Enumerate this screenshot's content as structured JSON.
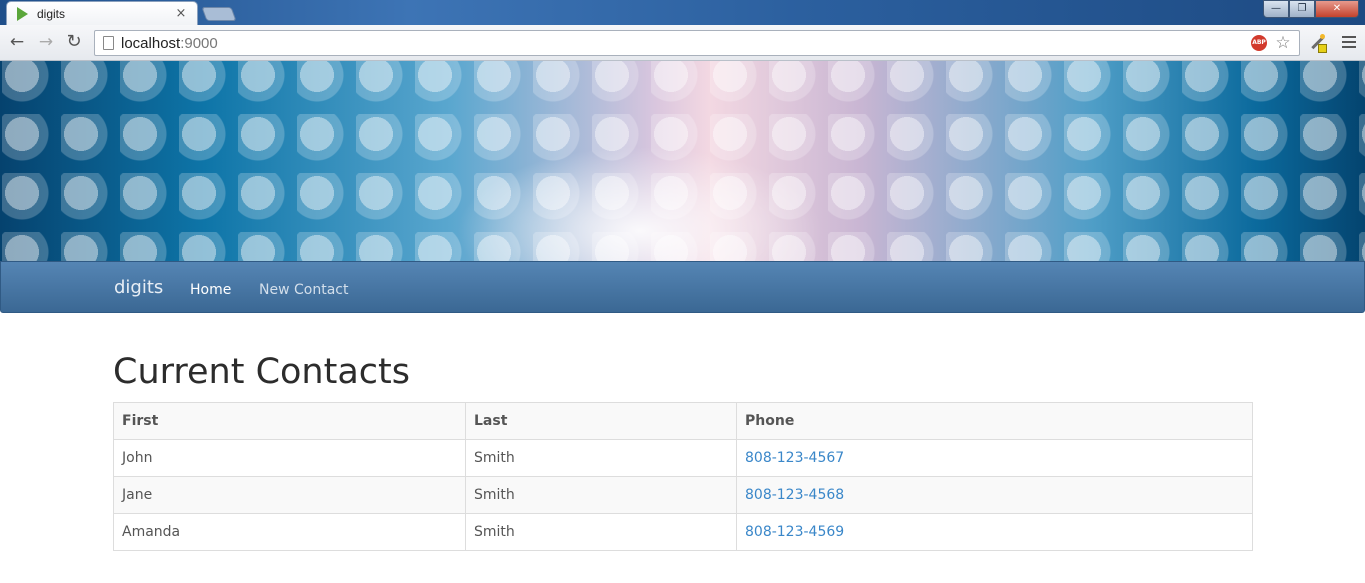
{
  "browser": {
    "tab_title": "digits",
    "tab_close": "×",
    "url_host": "localhost",
    "url_port": ":9000",
    "adblock_label": "ABP",
    "window_buttons": {
      "minimize": "—",
      "maximize": "❐",
      "close": "✕"
    },
    "icons": {
      "back": "←",
      "forward": "→",
      "reload": "↻",
      "bookmark": "☆"
    }
  },
  "navbar": {
    "brand": "digits",
    "links": [
      {
        "label": "Home",
        "active": true
      },
      {
        "label": "New Contact",
        "active": false
      }
    ]
  },
  "main": {
    "title": "Current Contacts",
    "table": {
      "headers": [
        "First",
        "Last",
        "Phone"
      ],
      "rows": [
        {
          "first": "John",
          "last": "Smith",
          "phone": "808-123-4567"
        },
        {
          "first": "Jane",
          "last": "Smith",
          "phone": "808-123-4568"
        },
        {
          "first": "Amanda",
          "last": "Smith",
          "phone": "808-123-4569"
        }
      ]
    }
  },
  "colors": {
    "navbar": "#4a78a6",
    "link": "#3a87c9",
    "text": "#555555",
    "heading": "#2c2c2c"
  }
}
